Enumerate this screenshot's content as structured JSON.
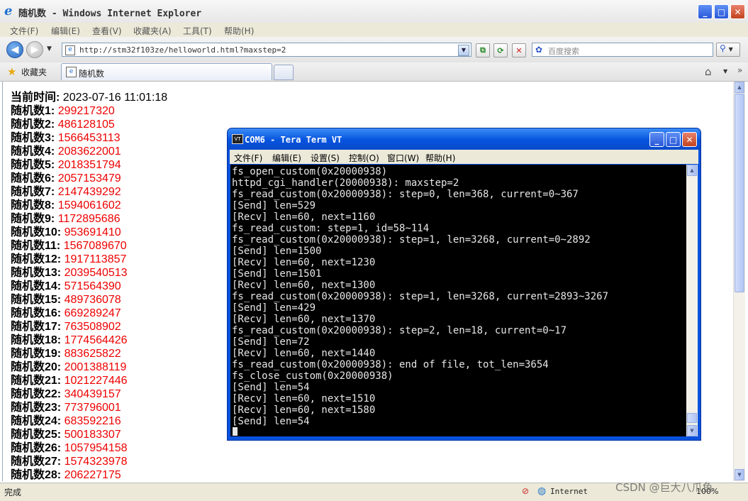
{
  "window": {
    "title": "随机数 - Windows Internet Explorer",
    "minimize": "_",
    "maximize": "□",
    "close": "✕"
  },
  "menu": [
    "文件(F)",
    "编辑(E)",
    "查看(V)",
    "收藏夹(A)",
    "工具(T)",
    "帮助(H)"
  ],
  "address": {
    "url": "http://stm32f103ze/helloworld.html?maxstep=2",
    "search_placeholder": "百度搜索"
  },
  "favorites": {
    "label": "收藏夹",
    "tab_title": "随机数"
  },
  "page": {
    "time_label": "当前时间:",
    "time_value": "2023-07-16 11:01:18",
    "randoms": [
      {
        "label": "随机数1:",
        "value": "299217320"
      },
      {
        "label": "随机数2:",
        "value": "486128105"
      },
      {
        "label": "随机数3:",
        "value": "1566453113"
      },
      {
        "label": "随机数4:",
        "value": "2083622001"
      },
      {
        "label": "随机数5:",
        "value": "2018351794"
      },
      {
        "label": "随机数6:",
        "value": "2057153479"
      },
      {
        "label": "随机数7:",
        "value": "2147439292"
      },
      {
        "label": "随机数8:",
        "value": "1594061602"
      },
      {
        "label": "随机数9:",
        "value": "1172895686"
      },
      {
        "label": "随机数10:",
        "value": "953691410"
      },
      {
        "label": "随机数11:",
        "value": "1567089670"
      },
      {
        "label": "随机数12:",
        "value": "1917113857"
      },
      {
        "label": "随机数13:",
        "value": "2039540513"
      },
      {
        "label": "随机数14:",
        "value": "571564390"
      },
      {
        "label": "随机数15:",
        "value": "489736078"
      },
      {
        "label": "随机数16:",
        "value": "669289247"
      },
      {
        "label": "随机数17:",
        "value": "763508902"
      },
      {
        "label": "随机数18:",
        "value": "1774564426"
      },
      {
        "label": "随机数19:",
        "value": "883625822"
      },
      {
        "label": "随机数20:",
        "value": "2001388119"
      },
      {
        "label": "随机数21:",
        "value": "1021227446"
      },
      {
        "label": "随机数22:",
        "value": "340439157"
      },
      {
        "label": "随机数23:",
        "value": "773796001"
      },
      {
        "label": "随机数24:",
        "value": "683592216"
      },
      {
        "label": "随机数25:",
        "value": "500183307"
      },
      {
        "label": "随机数26:",
        "value": "1057954158"
      },
      {
        "label": "随机数27:",
        "value": "1574323978"
      },
      {
        "label": "随机数28:",
        "value": "206227175"
      }
    ]
  },
  "status": {
    "text": "完成",
    "zone": "Internet",
    "zoom": "100%",
    "watermark": "CSDN @巨大八爪鱼"
  },
  "teraterm": {
    "title": "COM6 - Tera Term VT",
    "menu": [
      "文件(F)",
      "编辑(E)",
      "设置(S)",
      "控制(O)",
      "窗口(W)",
      "帮助(H)"
    ],
    "lines": [
      "fs_open_custom(0x20000938)",
      "httpd_cgi_handler(20000938): maxstep=2",
      "fs_read_custom(0x20000938): step=0, len=368, current=0~367",
      "[Send] len=529",
      "[Recv] len=60, next=1160",
      "fs_read_custom: step=1, id=58~114",
      "fs_read_custom(0x20000938): step=1, len=3268, current=0~2892",
      "[Send] len=1500",
      "[Recv] len=60, next=1230",
      "[Send] len=1501",
      "[Recv] len=60, next=1300",
      "fs_read_custom(0x20000938): step=1, len=3268, current=2893~3267",
      "[Send] len=429",
      "[Recv] len=60, next=1370",
      "fs_read_custom(0x20000938): step=2, len=18, current=0~17",
      "[Send] len=72",
      "[Recv] len=60, next=1440",
      "fs_read_custom(0x20000938): end of file, tot_len=3654",
      "fs_close_custom(0x20000938)",
      "[Send] len=54",
      "[Recv] len=60, next=1510",
      "[Recv] len=60, next=1580",
      "[Send] len=54"
    ]
  }
}
